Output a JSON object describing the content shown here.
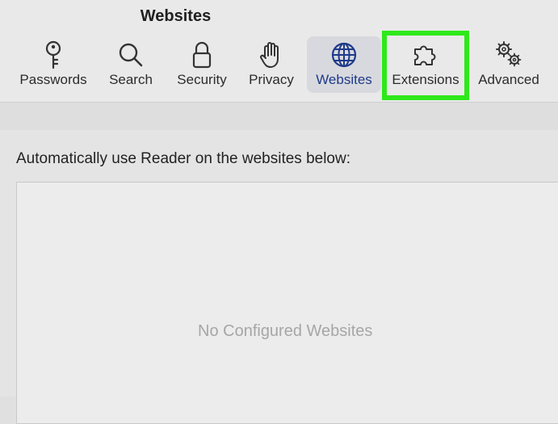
{
  "window": {
    "title": "Websites"
  },
  "toolbar": {
    "tabs": [
      {
        "label": "Passwords",
        "icon": "key-icon"
      },
      {
        "label": "Search",
        "icon": "magnifier-icon"
      },
      {
        "label": "Security",
        "icon": "lock-icon"
      },
      {
        "label": "Privacy",
        "icon": "hand-icon"
      },
      {
        "label": "Websites",
        "icon": "globe-icon",
        "selected": true
      },
      {
        "label": "Extensions",
        "icon": "puzzle-icon"
      },
      {
        "label": "Advanced",
        "icon": "gears-icon"
      }
    ],
    "accent_color": "#1e3a8a",
    "highlight_color": "#2ee81a"
  },
  "content": {
    "description": "Automatically use Reader on the websites below:",
    "empty_message": "No Configured Websites"
  }
}
